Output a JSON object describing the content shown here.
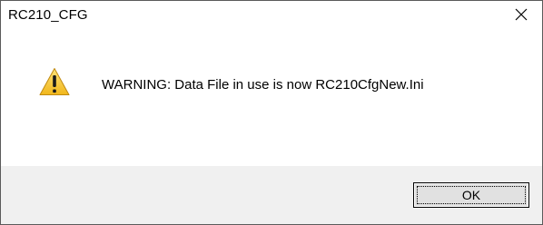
{
  "window": {
    "title": "RC210_CFG"
  },
  "icons": {
    "close": "close-icon",
    "warning": "warning-icon"
  },
  "dialog": {
    "message": "WARNING: Data File in use is now RC210CfgNew.Ini",
    "ok_label": "OK"
  },
  "colors": {
    "warning_yellow": "#f7c831",
    "footer_bg": "#f0f0f0"
  }
}
